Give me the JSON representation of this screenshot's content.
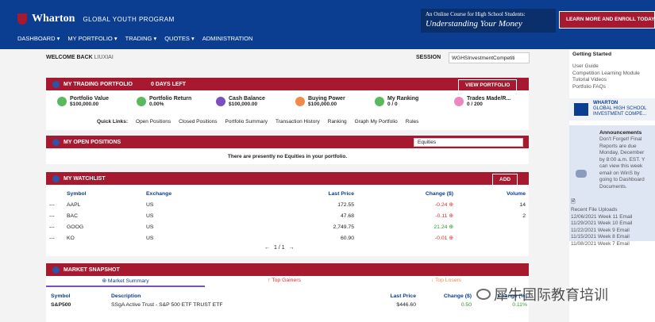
{
  "header": {
    "brand": "Wharton",
    "program": "GLOBAL YOUTH PROGRAM",
    "promo_line1": "An Online Course for High School Students:",
    "promo_line2": "Understanding Your Money",
    "learn_btn": "LEARN MORE AND ENROLL TODAY"
  },
  "nav": [
    "DASHBOARD ▾",
    "MY PORTFOLIO ▾",
    "TRADING ▾",
    "QUOTES ▾",
    "ADMINISTRATION"
  ],
  "welcome": {
    "label": "WELCOME BACK",
    "name": "LIUXIAI"
  },
  "session": {
    "label": "SESSION",
    "value": "WGHSInvestmentCompetiti"
  },
  "portfolio": {
    "title": "MY TRADING PORTFOLIO",
    "days_left": "0 DAYS LEFT",
    "view_btn": "VIEW PORTFOLIO",
    "stats": [
      {
        "title": "Portfolio Value",
        "value": "$100,000.00",
        "color": "#5cb85c"
      },
      {
        "title": "Portfolio Return",
        "value": "0.00%",
        "color": "#5cb85c"
      },
      {
        "title": "Cash Balance",
        "value": "$100,000.00",
        "color": "#7b4fbf"
      },
      {
        "title": "Buying Power",
        "value": "$100,000.00",
        "color": "#f08a4b"
      },
      {
        "title": "My Ranking",
        "value": "0 / 0",
        "color": "#5cb85c"
      },
      {
        "title": "Trades Made/R...",
        "value": "0 / 200",
        "color": "#e88ac0"
      }
    ],
    "quick_links_label": "Quick Links:",
    "quick_links": [
      "Open Positions",
      "Closed Positions",
      "Portfolio Summary",
      "Transaction History",
      "Ranking",
      "Graph My Portfolio",
      "Rules"
    ]
  },
  "open_positions": {
    "title": "MY OPEN POSITIONS",
    "select": "Equities",
    "empty": "There are presently no Equities in your portfolio."
  },
  "watchlist": {
    "title": "MY WATCHLIST",
    "add": "ADD",
    "columns": [
      "Symbol",
      "Exchange",
      "Last Price",
      "Change ($)",
      "Volume"
    ],
    "rows": [
      {
        "dash": "---",
        "symbol": "AAPL",
        "exchange": "US",
        "price": "172.55",
        "change": "-0.24",
        "volume": "14",
        "dir": "down"
      },
      {
        "dash": "---",
        "symbol": "BAC",
        "exchange": "US",
        "price": "47.68",
        "change": "-0.11",
        "volume": "2",
        "dir": "down"
      },
      {
        "dash": "---",
        "symbol": "GOOG",
        "exchange": "US",
        "price": "2,749.75",
        "change": "21.24",
        "volume": "",
        "dir": "up"
      },
      {
        "dash": "---",
        "symbol": "KO",
        "exchange": "US",
        "price": "60.90",
        "change": "-0.01",
        "volume": "",
        "dir": "down"
      }
    ],
    "pager": "1 / 1"
  },
  "snapshot": {
    "title": "MARKET SNAPSHOT",
    "tabs": [
      "Market Summary",
      "Top Gainers",
      "Top Losers"
    ],
    "columns": [
      "Symbol",
      "Description",
      "Last Price",
      "Change ($)",
      "Change (%)"
    ],
    "rows": [
      {
        "symbol": "S&P500",
        "desc": "SSgA Active Trust - S&P 500 ETF TRUST ETF",
        "price": "$446.60",
        "change": "0.50",
        "pct": "0.11%"
      }
    ]
  },
  "sidebar": {
    "getting_started": "Getting Started",
    "links": [
      "User Guide",
      "Competition Learning Module",
      "Tutorial Videos",
      "Portfolio FAQs"
    ],
    "wharton_card": [
      "WHARTON",
      "GLOBAL HIGH SCHOOL",
      "INVESTMENT COMPE..."
    ],
    "announce_title": "Announcements",
    "announce": [
      "Don't Forget! Final",
      "Reports are due",
      "Monday, December",
      "by 8:00 a.m. EST. Y",
      "can view this week",
      "email on WinS by",
      "going to Dashboard",
      "Documents."
    ],
    "uploads_title": "Recent File Uploads",
    "uploads": [
      "12/06/2021 Week 11 Email",
      "11/29/2021 Week 10 Email",
      "11/22/2021 Week 9 Email",
      "11/15/2021 Week 8 Email",
      "11/08/2021 Week 7 Email"
    ]
  },
  "watermark": "犀牛国际教育培训"
}
